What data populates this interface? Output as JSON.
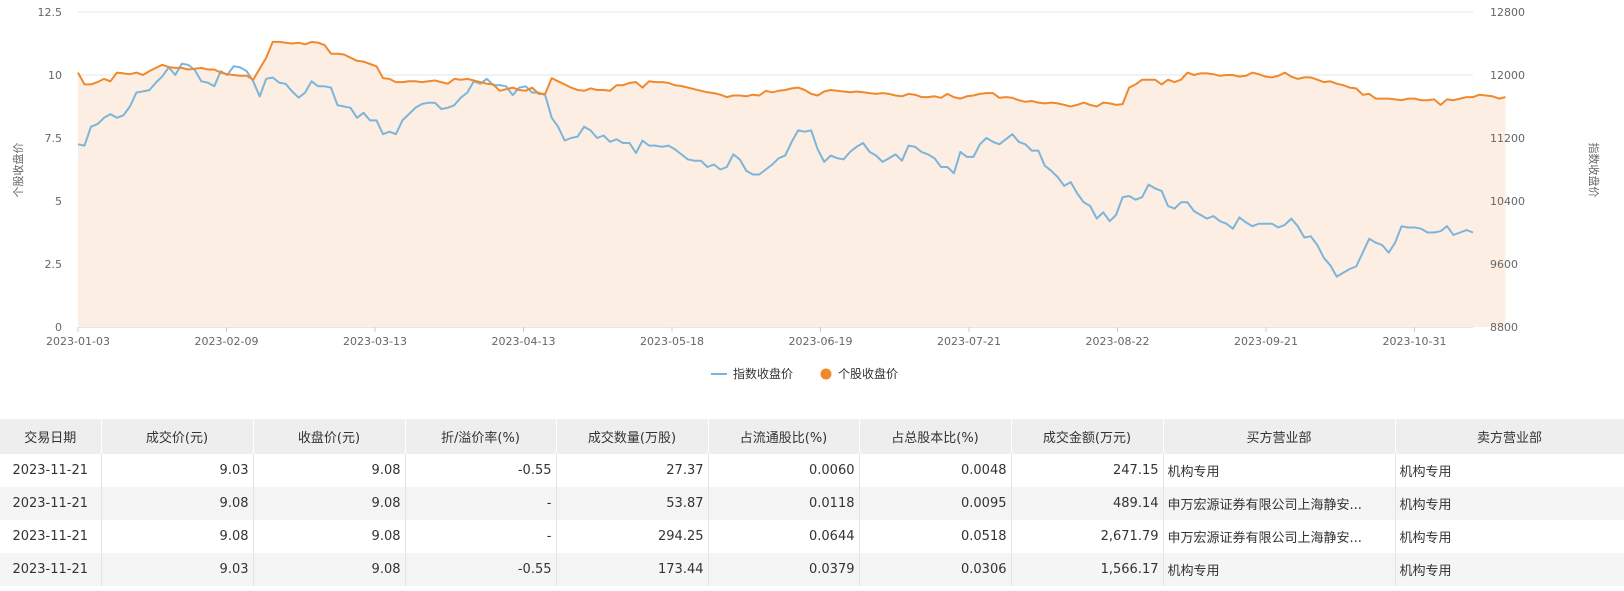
{
  "chart_data": {
    "type": "line",
    "series": [
      {
        "name": "指数收盘价",
        "axis": "left",
        "color": "#7cb5dc",
        "values": [
          7.25,
          7.2,
          7.95,
          8.05,
          8.3,
          8.45,
          8.3,
          8.4,
          8.75,
          9.3,
          9.35,
          9.4,
          9.7,
          9.95,
          10.3,
          10.0,
          10.45,
          10.4,
          10.2,
          9.75,
          9.7,
          9.55,
          10.15,
          10.0,
          10.35,
          10.3,
          10.15,
          9.75,
          9.15,
          9.85,
          9.9,
          9.7,
          9.65,
          9.35,
          9.1,
          9.3,
          9.75,
          9.55,
          9.55,
          9.5,
          8.8,
          8.75,
          8.7,
          8.3,
          8.5,
          8.2,
          8.2,
          7.65,
          7.75,
          7.65,
          8.2,
          8.45,
          8.7,
          8.85,
          8.9,
          8.9,
          8.65,
          8.7,
          8.8,
          9.1,
          9.3,
          9.75,
          9.65,
          9.85,
          9.6,
          9.6,
          9.55,
          9.2,
          9.5,
          9.55,
          9.3,
          9.3,
          9.2,
          8.3,
          7.95,
          7.4,
          7.5,
          7.55,
          7.95,
          7.8,
          7.5,
          7.6,
          7.35,
          7.45,
          7.3,
          7.3,
          6.9,
          7.4,
          7.2,
          7.2,
          7.15,
          7.2,
          7.05,
          6.85,
          6.65,
          6.6,
          6.6,
          6.35,
          6.45,
          6.25,
          6.35,
          6.85,
          6.65,
          6.2,
          6.05,
          6.05,
          6.25,
          6.45,
          6.7,
          6.8,
          7.35,
          7.8,
          7.75,
          7.8,
          7.05,
          6.55,
          6.8,
          6.7,
          6.65,
          6.95,
          7.15,
          7.3,
          6.95,
          6.8,
          6.55,
          6.7,
          6.85,
          6.6,
          7.2,
          7.15,
          6.95,
          6.85,
          6.7,
          6.35,
          6.35,
          6.1,
          6.95,
          6.75,
          6.75,
          7.25,
          7.5,
          7.35,
          7.25,
          7.45,
          7.65,
          7.35,
          7.25,
          7.0,
          7.0,
          6.4,
          6.2,
          5.95,
          5.6,
          5.75,
          5.3,
          4.95,
          4.8,
          4.3,
          4.55,
          4.2,
          4.45,
          5.15,
          5.2,
          5.05,
          5.15,
          5.65,
          5.5,
          5.4,
          4.8,
          4.7,
          4.95,
          4.95,
          4.6,
          4.45,
          4.3,
          4.4,
          4.2,
          4.1,
          3.9,
          4.35,
          4.15,
          4.0,
          4.1,
          4.1,
          4.1,
          3.95,
          4.05,
          4.3,
          4.0,
          3.55,
          3.6,
          3.25,
          2.75,
          2.45,
          2.0,
          2.15,
          2.3,
          2.4,
          2.95,
          3.5,
          3.35,
          3.25,
          2.95,
          3.35,
          4.0,
          3.95,
          3.95,
          3.9,
          3.75,
          3.75,
          3.8,
          4.0,
          3.65,
          3.75,
          3.85,
          3.75
        ]
      },
      {
        "name": "个股收盘价",
        "axis": "right",
        "color": "#f0892e",
        "values": [
          12030,
          11880,
          11880,
          11910,
          11950,
          11920,
          12030,
          12020,
          12010,
          12030,
          12000,
          12050,
          12090,
          12130,
          12100,
          12090,
          12090,
          12070,
          12080,
          12090,
          12070,
          12070,
          12030,
          12010,
          12000,
          11990,
          11990,
          11940,
          12080,
          12220,
          12420,
          12420,
          12410,
          12400,
          12410,
          12390,
          12420,
          12410,
          12380,
          12270,
          12270,
          12260,
          12220,
          12180,
          12170,
          12140,
          12110,
          11960,
          11950,
          11910,
          11910,
          11920,
          11920,
          11910,
          11920,
          11930,
          11910,
          11890,
          11950,
          11940,
          11950,
          11930,
          11910,
          11890,
          11880,
          11800,
          11820,
          11840,
          11810,
          11800,
          11840,
          11760,
          11760,
          11960,
          11920,
          11880,
          11840,
          11810,
          11800,
          11830,
          11810,
          11810,
          11800,
          11870,
          11870,
          11900,
          11910,
          11840,
          11920,
          11910,
          11910,
          11900,
          11870,
          11860,
          11840,
          11820,
          11800,
          11780,
          11770,
          11750,
          11720,
          11740,
          11740,
          11730,
          11750,
          11740,
          11800,
          11780,
          11800,
          11810,
          11830,
          11840,
          11810,
          11760,
          11740,
          11790,
          11810,
          11800,
          11790,
          11780,
          11790,
          11780,
          11770,
          11760,
          11770,
          11760,
          11740,
          11730,
          11760,
          11750,
          11720,
          11720,
          11730,
          11710,
          11760,
          11720,
          11700,
          11730,
          11740,
          11760,
          11770,
          11770,
          11710,
          11720,
          11710,
          11680,
          11660,
          11670,
          11650,
          11640,
          11650,
          11640,
          11620,
          11600,
          11620,
          11650,
          11620,
          11600,
          11650,
          11640,
          11620,
          11630,
          11840,
          11880,
          11940,
          11940,
          11940,
          11880,
          11940,
          11910,
          11940,
          12030,
          12000,
          12020,
          12020,
          12010,
          11990,
          12000,
          12000,
          11980,
          11990,
          12030,
          12010,
          11980,
          11970,
          11990,
          12030,
          11980,
          11950,
          11970,
          11970,
          11940,
          11910,
          11920,
          11890,
          11870,
          11840,
          11830,
          11750,
          11760,
          11700,
          11700,
          11700,
          11690,
          11680,
          11700,
          11700,
          11680,
          11680,
          11690,
          11620,
          11690,
          11680,
          11700,
          11720,
          11720,
          11750,
          11740,
          11730,
          11700,
          11720
        ]
      }
    ],
    "x_ticks": [
      "2023-01-03",
      "2023-02-09",
      "2023-03-13",
      "2023-04-13",
      "2023-05-18",
      "2023-06-19",
      "2023-07-21",
      "2023-08-22",
      "2023-09-21",
      "2023-10-31"
    ],
    "yleft_ticks": [
      "0",
      "2.5",
      "5",
      "7.5",
      "10",
      "12.5"
    ],
    "yleft_lim": [
      0,
      12.5
    ],
    "yright_ticks": [
      "8800",
      "9600",
      "10400",
      "11200",
      "12000",
      "12800"
    ],
    "yright_lim": [
      8800,
      12800
    ],
    "ylabel_left": "个股收盘价",
    "ylabel_right": "指数收盘价",
    "legend": [
      "指数收盘价",
      "个股收盘价"
    ],
    "legend_position": "bottom-center",
    "grid": true,
    "fill_color": "#fdeee3"
  },
  "table": {
    "headers": [
      "交易日期",
      "成交价(元)",
      "收盘价(元)",
      "折/溢价率(%)",
      "成交数量(万股)",
      "占流通股比(%)",
      "占总股本比(%)",
      "成交金额(万元)",
      "买方营业部",
      "卖方营业部"
    ],
    "rows": [
      [
        "2023-11-21",
        "9.03",
        "9.08",
        "-0.55",
        "27.37",
        "0.0060",
        "0.0048",
        "247.15",
        "机构专用",
        "机构专用"
      ],
      [
        "2023-11-21",
        "9.08",
        "9.08",
        "-",
        "53.87",
        "0.0118",
        "0.0095",
        "489.14",
        "申万宏源证券有限公司上海静安...",
        "机构专用"
      ],
      [
        "2023-11-21",
        "9.08",
        "9.08",
        "-",
        "294.25",
        "0.0644",
        "0.0518",
        "2,671.79",
        "申万宏源证券有限公司上海静安...",
        "机构专用"
      ],
      [
        "2023-11-21",
        "9.03",
        "9.08",
        "-0.55",
        "173.44",
        "0.0379",
        "0.0306",
        "1,566.17",
        "机构专用",
        "机构专用"
      ]
    ]
  }
}
